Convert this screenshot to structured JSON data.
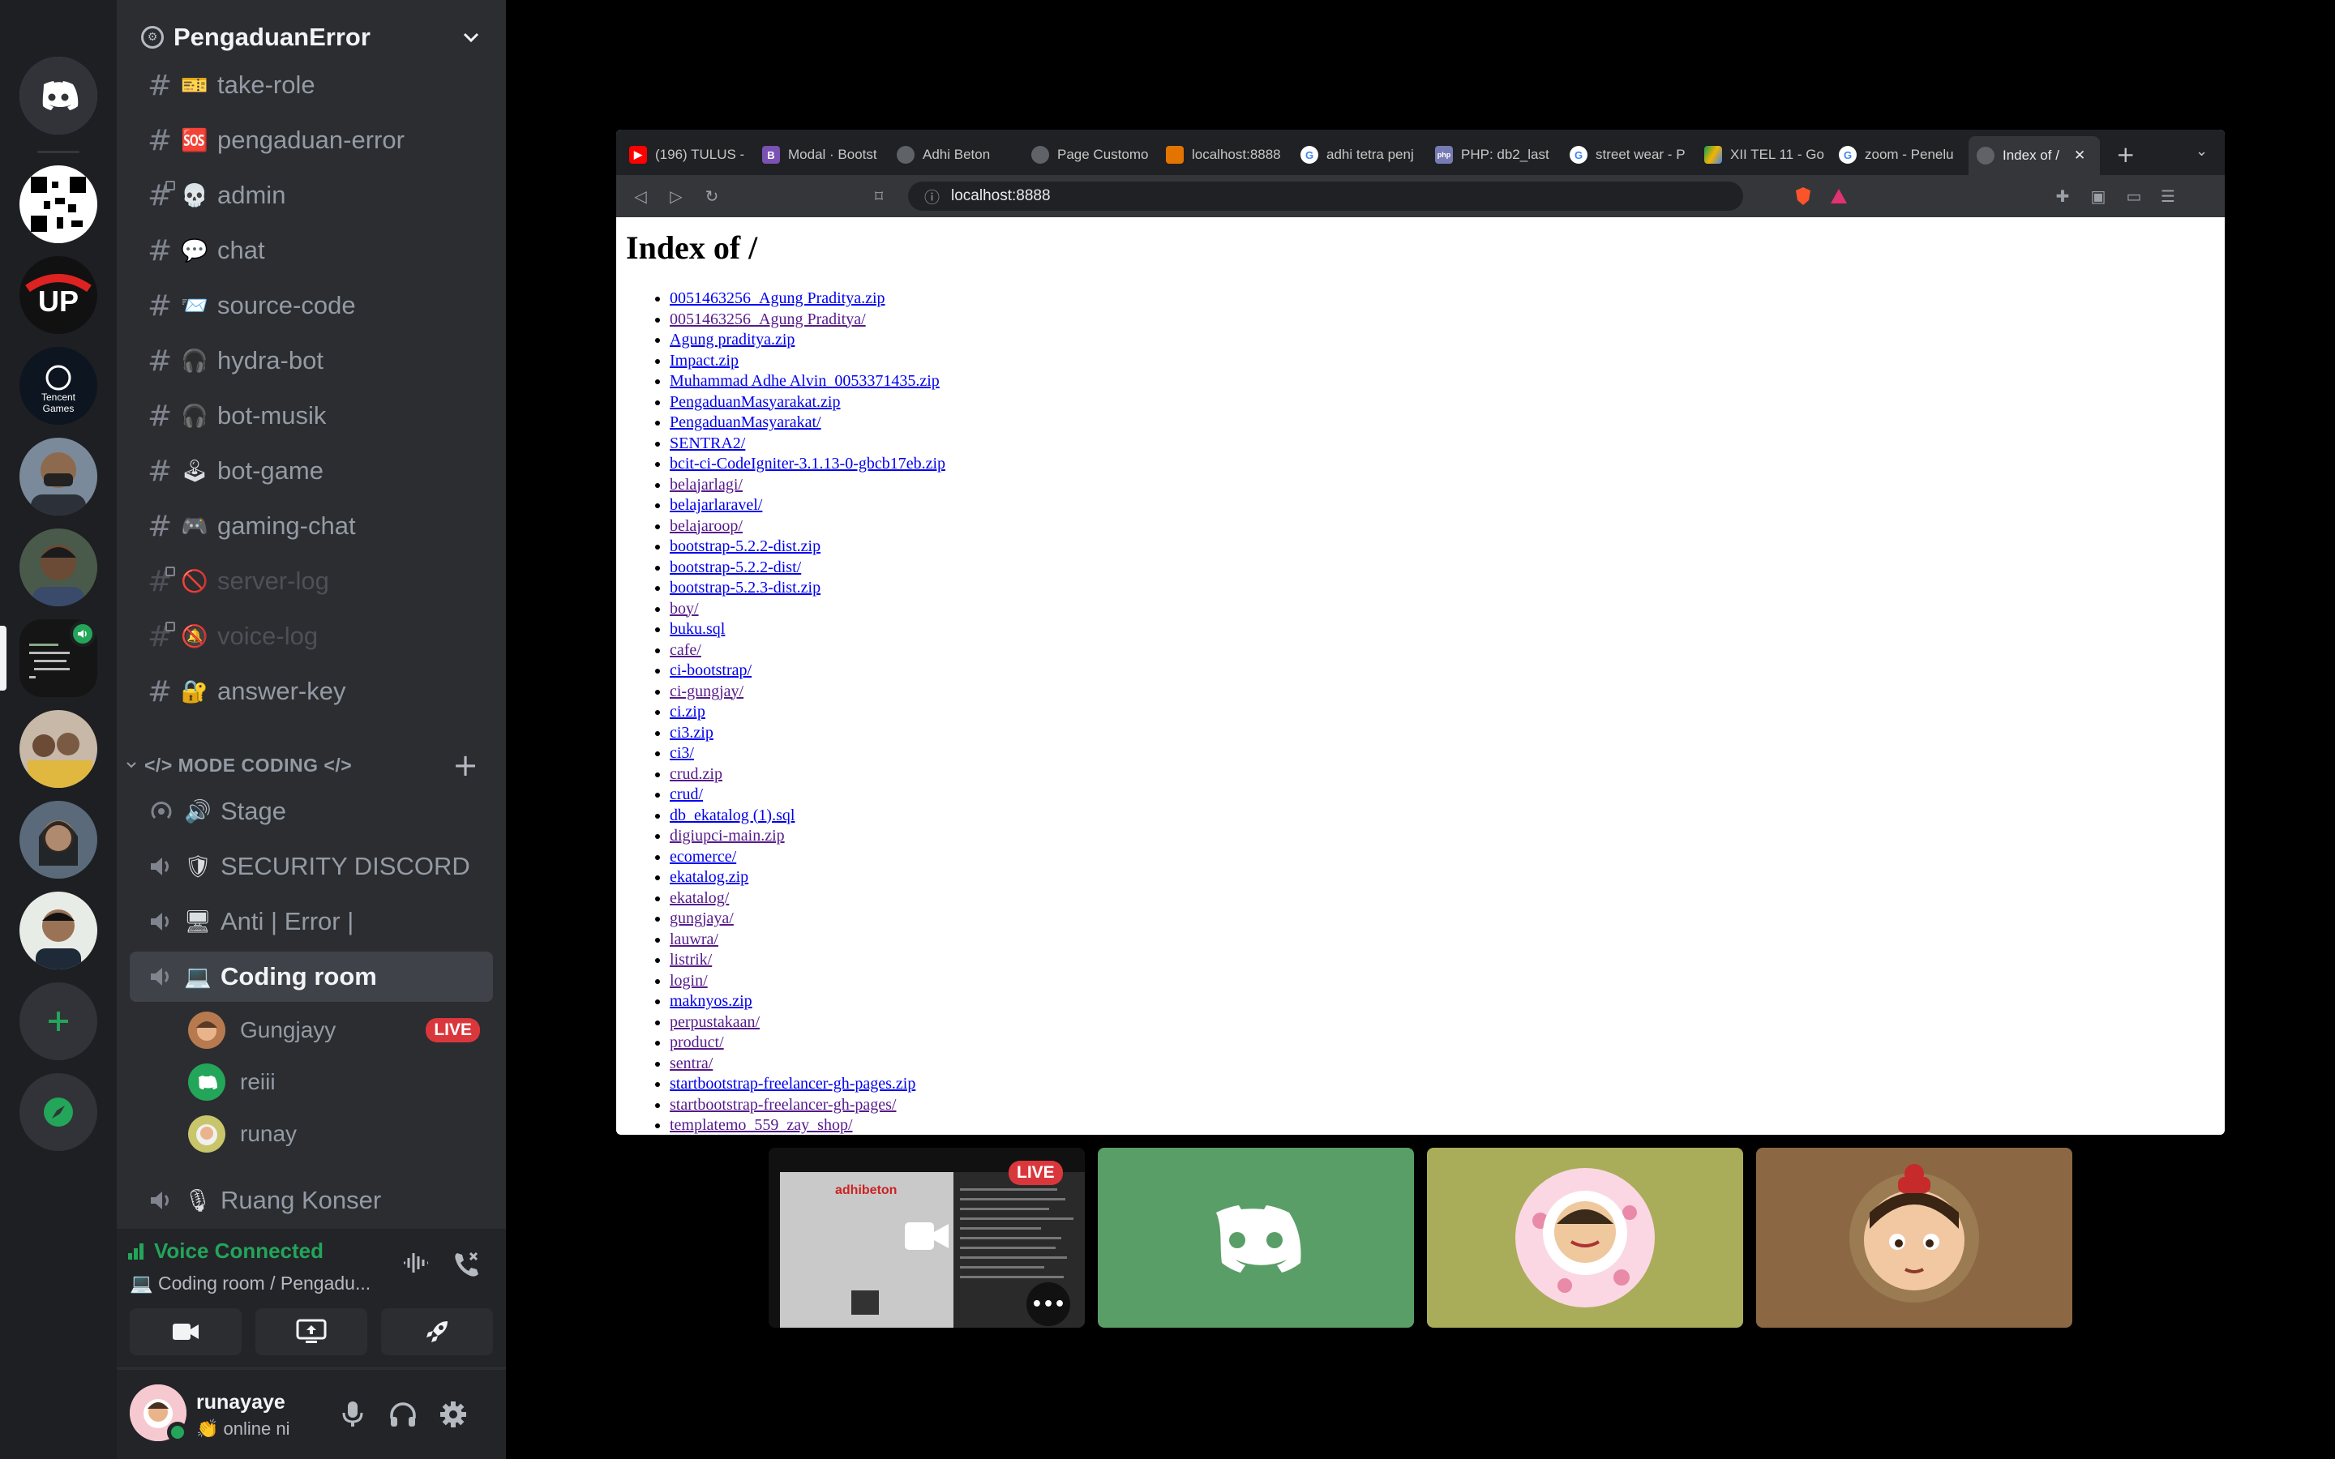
{
  "guild": {
    "name": "PengaduanError"
  },
  "text_channels": [
    {
      "name": "take-role",
      "emoji": "🎫"
    },
    {
      "name": "pengaduan-error",
      "emoji": "🆘"
    },
    {
      "name": "admin",
      "emoji": "💀"
    },
    {
      "name": "chat",
      "emoji": "💬"
    },
    {
      "name": "source-code",
      "emoji": "📨"
    },
    {
      "name": "hydra-bot",
      "emoji": "🎧"
    },
    {
      "name": "bot-musik",
      "emoji": "🎧"
    },
    {
      "name": "bot-game",
      "emoji": "🕹"
    },
    {
      "name": "gaming-chat",
      "emoji": "🎮"
    },
    {
      "name": "server-log",
      "emoji": "🚫"
    },
    {
      "name": "voice-log",
      "emoji": "🔕"
    },
    {
      "name": "answer-key",
      "emoji": "🔐"
    }
  ],
  "category": {
    "label": "</> MODE CODING </>"
  },
  "voice_channels": [
    {
      "name": "Stage",
      "emoji": "🔊"
    },
    {
      "name": "SECURITY DISCORD",
      "emoji": "🛡"
    },
    {
      "name": "Anti | Error |",
      "emoji": "🖥"
    },
    {
      "name": "Coding room",
      "emoji": "💻"
    },
    {
      "name": "Ruang Konser",
      "emoji": "🎙"
    }
  ],
  "voice_users": [
    {
      "name": "Gungjayy",
      "badge": "LIVE"
    },
    {
      "name": "reiii"
    },
    {
      "name": "runay"
    }
  ],
  "voice_panel": {
    "title": "Voice Connected",
    "subtitle": "💻 Coding room / Pengadu..."
  },
  "user": {
    "name": "runayaye",
    "status": "👏 online ni"
  },
  "browser": {
    "tabs": [
      {
        "title": "(196) TULUS -",
        "favicon_color": "#ff0000"
      },
      {
        "title": "Modal · Bootst",
        "favicon_color": "#7952b3"
      },
      {
        "title": "Adhi Beton",
        "favicon_color": "#5f6368"
      },
      {
        "title": "Page Customo",
        "favicon_color": "#5f6368"
      },
      {
        "title": "localhost:8888",
        "favicon_color": "#e37400"
      },
      {
        "title": "adhi tetra penj",
        "favicon_color": "#4285f4"
      },
      {
        "title": "PHP: db2_last",
        "favicon_color": "#777bb4"
      },
      {
        "title": "street wear - P",
        "favicon_color": "#4285f4"
      },
      {
        "title": "XII TEL 11 - Go",
        "favicon_color": "#0f9d58"
      },
      {
        "title": "zoom - Penelu",
        "favicon_color": "#4285f4"
      },
      {
        "title": "Index of /",
        "favicon_color": "#5f6368"
      }
    ],
    "url": "localhost:8888",
    "page_title": "Index of /",
    "files": [
      "0051463256_Agung Praditya.zip",
      "0051463256_Agung Praditya/",
      "Agung praditya.zip",
      "Impact.zip",
      "Muhammad Adhe Alvin_0053371435.zip",
      "PengaduanMasyarakat.zip",
      "PengaduanMasyarakat/",
      "SENTRA2/",
      "bcit-ci-CodeIgniter-3.1.13-0-gbcb17eb.zip",
      "belajarlagi/",
      "belajarlaravel/",
      "belajaroop/",
      "bootstrap-5.2.2-dist.zip",
      "bootstrap-5.2.2-dist/",
      "bootstrap-5.2.3-dist.zip",
      "boy/",
      "buku.sql",
      "cafe/",
      "ci-bootstrap/",
      "ci-gungjay/",
      "ci.zip",
      "ci3.zip",
      "ci3/",
      "crud.zip",
      "crud/",
      "db_ekatalog (1).sql",
      "digiupci-main.zip",
      "ecomerce/",
      "ekatalog.zip",
      "ekatalog/",
      "gungjaya/",
      "lauwra/",
      "listrik/",
      "login/",
      "maknyos.zip",
      "perpustakaan/",
      "product/",
      "sentra/",
      "startbootstrap-freelancer-gh-pages.zip",
      "startbootstrap-freelancer-gh-pages/",
      "templatemo_559_zay_shop/"
    ]
  },
  "tiles": {
    "stream_preview": {
      "brand": "adhibeton",
      "badge": "LIVE"
    }
  },
  "colors": {
    "green": "#23a55a",
    "live_red": "#da373c",
    "tile_discord_green": "#5a9e67",
    "tile_olive": "#a9ad5a",
    "tile_brown": "#8b6843"
  }
}
